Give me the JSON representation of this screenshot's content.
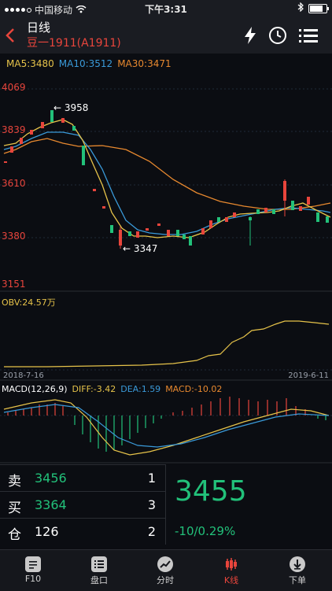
{
  "status_bar": {
    "carrier": "中国移动",
    "time": "下午3:31"
  },
  "header": {
    "period": "日线",
    "contract": "豆一1911(A1911)"
  },
  "ma": {
    "ma5": "MA5:3480",
    "ma10": "MA10:3512",
    "ma30": "MA30:3471"
  },
  "price_axis": [
    "4069",
    "3839",
    "3610",
    "3380",
    "3151"
  ],
  "annotations": {
    "high": "3958",
    "low": "3347"
  },
  "obv_label": "OBV:24.57万",
  "dates": {
    "start": "2018-7-16",
    "end": "2019-6-11"
  },
  "macd": {
    "params": "MACD(12,26,9)",
    "diff": "DIFF:-3.42",
    "dea": "DEA:1.59",
    "value": "MACD:-10.02"
  },
  "trade": {
    "sell": {
      "label": "卖",
      "price": "3456",
      "qty": "1"
    },
    "buy": {
      "label": "买",
      "price": "3364",
      "qty": "3"
    },
    "position": {
      "label": "仓",
      "value": "126",
      "qty": "2"
    },
    "last_price": "3455",
    "change": "-10/0.29%"
  },
  "tabs": [
    "F10",
    "盘口",
    "分时",
    "K线",
    "下单"
  ],
  "active_tab": "K线",
  "colors": {
    "up": "#e8453c",
    "down": "#22c17a",
    "ma5": "#e6c34a",
    "ma10": "#3a9ad9",
    "ma30": "#e8892f"
  }
}
